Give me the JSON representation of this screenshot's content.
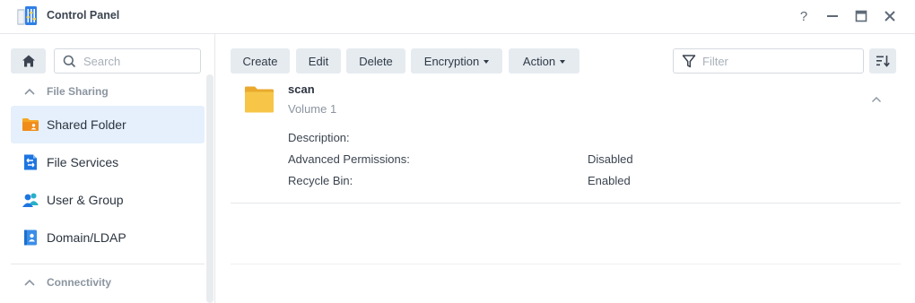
{
  "window": {
    "title": "Control Panel",
    "help_label": "?"
  },
  "sidebar": {
    "search_placeholder": "Search",
    "sections": [
      {
        "label": "File Sharing"
      },
      {
        "label": "Connectivity"
      }
    ],
    "items": [
      {
        "label": "Shared Folder",
        "icon": "shared-folder-icon",
        "active": true
      },
      {
        "label": "File Services",
        "icon": "file-services-icon",
        "active": false
      },
      {
        "label": "User & Group",
        "icon": "user-group-icon",
        "active": false
      },
      {
        "label": "Domain/LDAP",
        "icon": "domain-ldap-icon",
        "active": false
      }
    ]
  },
  "toolbar": {
    "create": "Create",
    "edit": "Edit",
    "delete": "Delete",
    "encryption": "Encryption",
    "action": "Action",
    "filter_placeholder": "Filter"
  },
  "folder": {
    "name": "scan",
    "volume": "Volume 1",
    "details": [
      {
        "label": "Description:",
        "value": ""
      },
      {
        "label": "Advanced Permissions:",
        "value": "Disabled"
      },
      {
        "label": "Recycle Bin:",
        "value": "Enabled"
      }
    ]
  },
  "colors": {
    "accent": "#1a73e8",
    "active_bg": "#e5f0fc",
    "folder": "#f7c648",
    "button_bg": "#e6ebf0"
  }
}
